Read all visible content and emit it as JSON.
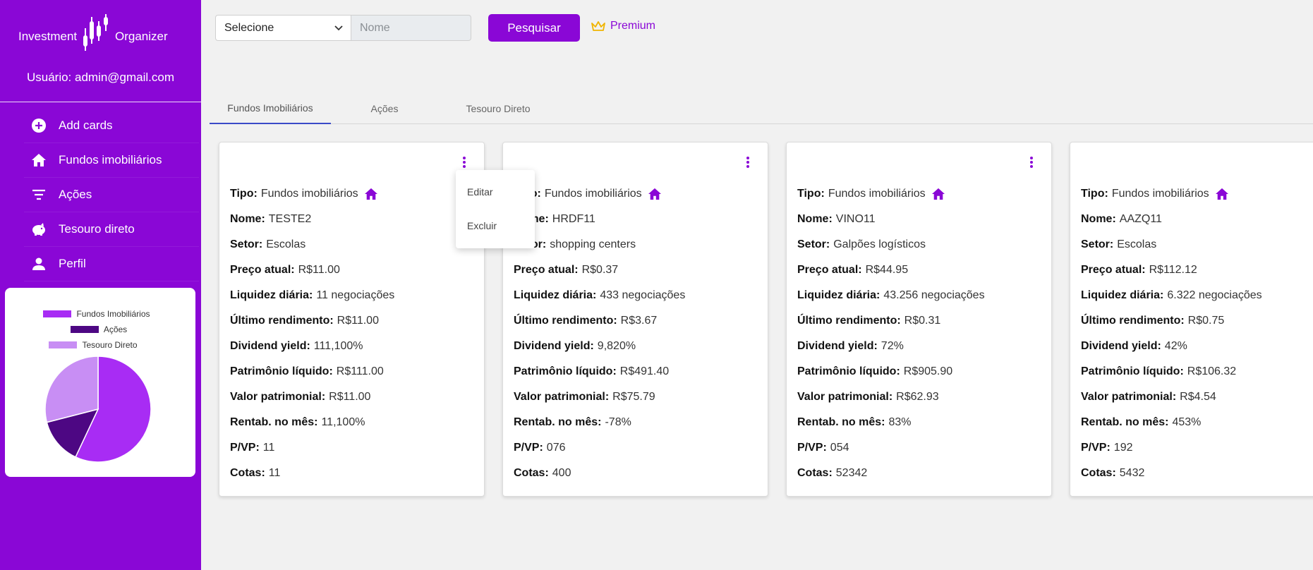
{
  "brand": {
    "left": "Investment",
    "right": "Organizer"
  },
  "user": {
    "label": "Usuário: admin@gmail.com"
  },
  "sidebar": {
    "items": [
      {
        "label": "Add cards",
        "icon": "add-circle-icon"
      },
      {
        "label": "Fundos imobiliários",
        "icon": "home-icon"
      },
      {
        "label": "Ações",
        "icon": "filter-icon"
      },
      {
        "label": "Tesouro direto",
        "icon": "piggy-bank-icon"
      },
      {
        "label": "Perfil",
        "icon": "person-icon"
      }
    ]
  },
  "chart_data": {
    "type": "pie",
    "labels": [
      "Fundos Imobiliários",
      "Ações",
      "Tesouro Direto"
    ],
    "values": [
      57,
      14,
      29
    ],
    "colors": [
      "#a82cf4",
      "#4d0783",
      "#c88ef4"
    ],
    "legend_position": "top"
  },
  "toolbar": {
    "select_value": "Selecione",
    "name_placeholder": "Nome",
    "search_label": "Pesquisar",
    "premium_label": "Premium"
  },
  "tabs": [
    {
      "label": "Fundos Imobiliários",
      "active": true
    },
    {
      "label": "Ações",
      "active": false
    },
    {
      "label": "Tesouro Direto",
      "active": false
    }
  ],
  "labels": {
    "tipo": "Tipo:",
    "nome": "Nome:",
    "setor": "Setor:",
    "preco": "Preço atual:",
    "liquidez": "Liquidez diária:",
    "rendimento": "Último rendimento:",
    "dy": "Dividend yield:",
    "pl": "Patrimônio líquido:",
    "vp": "Valor patrimonial:",
    "rentab": "Rentab. no mês:",
    "pvp": "P/VP:",
    "cotas": "Cotas:"
  },
  "cards": [
    {
      "tipo": "Fundos imobiliários",
      "nome": "TESTE2",
      "setor": "Escolas",
      "preco": "R$11.00",
      "liquidez": "11 negociações",
      "rendimento": "R$11.00",
      "dy": "111,100%",
      "pl": "R$111.00",
      "vp": "R$11.00",
      "rentab": "11,100%",
      "pvp": "11",
      "cotas": "11"
    },
    {
      "tipo": "Fundos imobiliários",
      "nome": "HRDF11",
      "setor": "shopping centers",
      "preco": "R$0.37",
      "liquidez": "433 negociações",
      "rendimento": "R$3.67",
      "dy": "9,820%",
      "pl": "R$491.40",
      "vp": "R$75.79",
      "rentab": "-78%",
      "pvp": "076",
      "cotas": "400"
    },
    {
      "tipo": "Fundos imobiliários",
      "nome": "VINO11",
      "setor": "Galpões logísticos",
      "preco": "R$44.95",
      "liquidez": "43.256 negociações",
      "rendimento": "R$0.31",
      "dy": "72%",
      "pl": "R$905.90",
      "vp": "R$62.93",
      "rentab": "83%",
      "pvp": "054",
      "cotas": "52342"
    },
    {
      "tipo": "Fundos imobiliários",
      "nome": "AAZQ11",
      "setor": "Escolas",
      "preco": "R$112.12",
      "liquidez": "6.322 negociações",
      "rendimento": "R$0.75",
      "dy": "42%",
      "pl": "R$106.32",
      "vp": "R$4.54",
      "rentab": "453%",
      "pvp": "192",
      "cotas": "5432"
    }
  ],
  "context_menu": {
    "edit": "Editar",
    "delete": "Excluir"
  }
}
